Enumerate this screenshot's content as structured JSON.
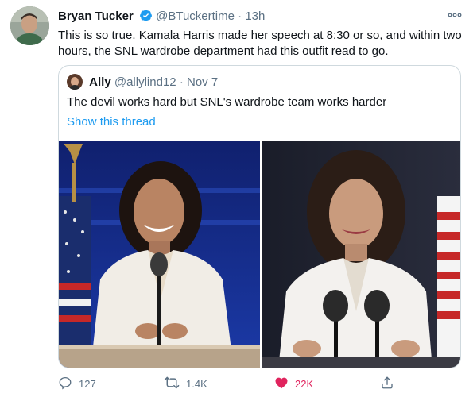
{
  "tweet": {
    "author_name": "Bryan Tucker",
    "author_handle": "@BTuckertime",
    "separator": "·",
    "time": "13h",
    "text": "This is so true. Kamala Harris made her speech at 8:30 or so, and within two hours, the SNL wardrobe department had this outfit read to go."
  },
  "quoted": {
    "author_name": "Ally",
    "author_handle": "@allylind12",
    "separator": "·",
    "date": "Nov 7",
    "text": "The devil works hard but SNL's wardrobe team works harder",
    "show_thread": "Show this thread"
  },
  "actions": {
    "reply_count": "127",
    "retweet_count": "1.4K",
    "like_count": "22K"
  },
  "icons": {
    "verified": "verified-badge-icon",
    "more": "more-icon",
    "reply": "reply-icon",
    "retweet": "retweet-icon",
    "like": "heart-icon",
    "share": "share-icon"
  },
  "colors": {
    "link": "#1d9bf0",
    "like": "#e0245e",
    "muted": "#5b7083"
  }
}
